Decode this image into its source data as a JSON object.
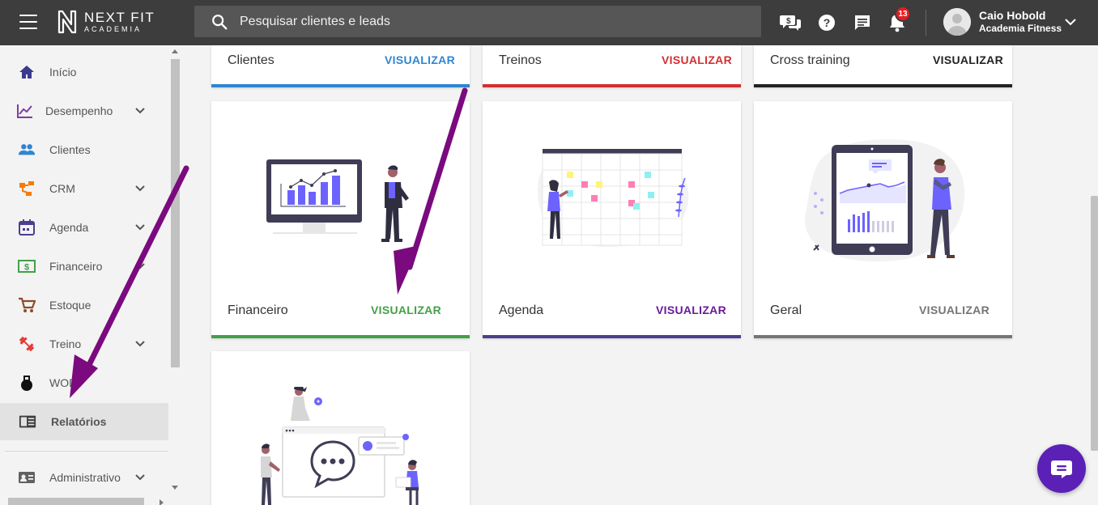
{
  "brand": {
    "name": "NEXT FIT",
    "sub": "ACADEMIA"
  },
  "search": {
    "placeholder": "Pesquisar clientes e leads"
  },
  "notifications": {
    "count": "13"
  },
  "user": {
    "name": "Caio Hobold",
    "org": "Academia Fitness"
  },
  "sidebar": {
    "items": [
      {
        "label": "Início",
        "icon": "home-icon",
        "expandable": false
      },
      {
        "label": "Desempenho",
        "icon": "chart-line-icon",
        "expandable": true
      },
      {
        "label": "Clientes",
        "icon": "people-icon",
        "expandable": false
      },
      {
        "label": "CRM",
        "icon": "flow-icon",
        "expandable": true
      },
      {
        "label": "Agenda",
        "icon": "calendar-icon",
        "expandable": true
      },
      {
        "label": "Financeiro",
        "icon": "money-icon",
        "expandable": true
      },
      {
        "label": "Estoque",
        "icon": "cart-icon",
        "expandable": false
      },
      {
        "label": "Treino",
        "icon": "dumbbell-icon",
        "expandable": true
      },
      {
        "label": "WOD",
        "icon": "kettlebell-icon",
        "expandable": false
      },
      {
        "label": "Relatórios",
        "icon": "report-icon",
        "expandable": false,
        "active": true
      },
      {
        "label": "Administrativo",
        "icon": "id-card-icon",
        "expandable": true
      }
    ]
  },
  "cards": [
    {
      "title": "Clientes",
      "link": "VISUALIZAR",
      "color": "#2f86d1"
    },
    {
      "title": "Treinos",
      "link": "VISUALIZAR",
      "color": "#d32f2f"
    },
    {
      "title": "Cross training",
      "link": "VISUALIZAR",
      "color": "#222222"
    },
    {
      "title": "Financeiro",
      "link": "VISUALIZAR",
      "color": "#43a047"
    },
    {
      "title": "Agenda",
      "link": "VISUALIZAR",
      "color": "#6a1b9a"
    },
    {
      "title": "Geral",
      "link": "VISUALIZAR",
      "color": "#757575"
    }
  ],
  "colors": {
    "topbar": "#3d3d3d",
    "accent": "#6c63ff",
    "annotation": "#7a0a7e",
    "fab": "#5b21b6"
  }
}
